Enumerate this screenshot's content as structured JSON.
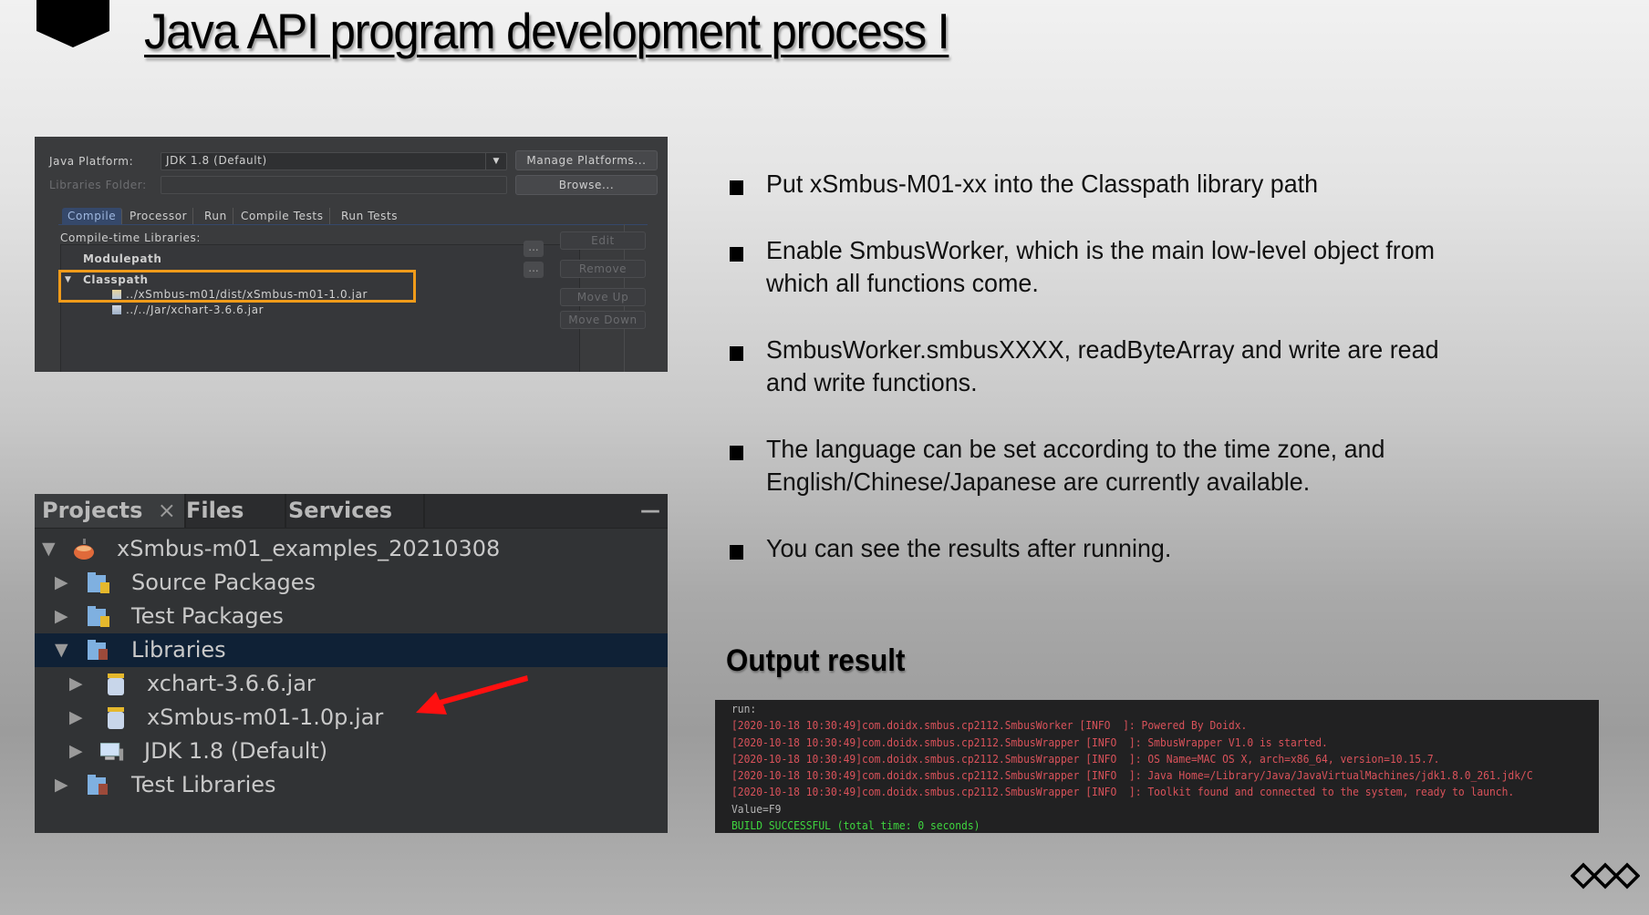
{
  "slide": {
    "title": "Java API program development process I",
    "output_heading": "Output result",
    "bullets": [
      {
        "lines": [
          "Put xSmbus-M01-xx into the Classpath library path"
        ]
      },
      {
        "lines": [
          "Enable SmbusWorker, which is the main low-level object from",
          "which all functions come."
        ]
      },
      {
        "lines": [
          "SmbusWorker.smbusXXXX, readByteArray and write are read",
          "and write functions."
        ]
      },
      {
        "lines": [
          "The language can be set according to the time zone, and",
          "English/Chinese/Japanese are currently available."
        ]
      },
      {
        "lines": [
          "You can see the results after running."
        ]
      }
    ]
  },
  "properties_dialog": {
    "java_platform_label": "Java Platform:",
    "java_platform_value": "JDK 1.8 (Default)",
    "manage_platforms_button": "Manage Platforms...",
    "libraries_folder_label": "Libraries Folder:",
    "libraries_folder_value": "",
    "browse_button": "Browse...",
    "tabs": [
      "Compile",
      "Processor",
      "Run",
      "Compile Tests",
      "Run Tests"
    ],
    "active_tab": "Compile",
    "compile_time_label": "Compile-time Libraries:",
    "tree": {
      "modulepath": "Modulepath",
      "classpath": "Classpath",
      "classpath_items": [
        "../xSmbus-m01/dist/xSmbus-m01-1.0.jar",
        "../../Jar/xchart-3.6.6.jar"
      ]
    },
    "more_button": "...",
    "side_buttons": [
      "Edit",
      "Remove",
      "Move Up",
      "Move Down"
    ],
    "highlight_color": "#f09b1a"
  },
  "projects_panel": {
    "tabs": [
      "Projects",
      "Files",
      "Services"
    ],
    "close_glyph": "×",
    "minimize_glyph": "—",
    "tree": {
      "project": "xSmbus-m01_examples_20210308",
      "source_packages": "Source Packages",
      "test_packages": "Test Packages",
      "libraries": "Libraries",
      "library_items": [
        "xchart-3.6.6.jar",
        "xSmbus-m01-1.0p.jar",
        "JDK 1.8 (Default)"
      ],
      "test_libraries": "Test Libraries"
    },
    "selected_row": "Libraries",
    "arrow_color": "#ff1010"
  },
  "terminal": {
    "run_label": "run:",
    "log_lines": [
      "[2020-10-18 10:30:49]com.doidx.smbus.cp2112.SmbusWorker [INFO  ]: Powered By Doidx.",
      "[2020-10-18 10:30:49]com.doidx.smbus.cp2112.SmbusWrapper [INFO  ]: SmbusWrapper V1.0 is started.",
      "[2020-10-18 10:30:49]com.doidx.smbus.cp2112.SmbusWrapper [INFO  ]: OS Name=MAC OS X, arch=x86_64, version=10.15.7.",
      "[2020-10-18 10:30:49]com.doidx.smbus.cp2112.SmbusWrapper [INFO  ]: Java Home=/Library/Java/JavaVirtualMachines/jdk1.8.0_261.jdk/C",
      "[2020-10-18 10:30:49]com.doidx.smbus.cp2112.SmbusWrapper [INFO  ]: Toolkit found and connected to the system, ready to launch."
    ],
    "value_line": "Value=F9",
    "build_line": "BUILD SUCCESSFUL (total time: 0 seconds)",
    "colors": {
      "log": "#d9525a",
      "success": "#3fd63f",
      "plain": "#b5b5b5"
    }
  }
}
